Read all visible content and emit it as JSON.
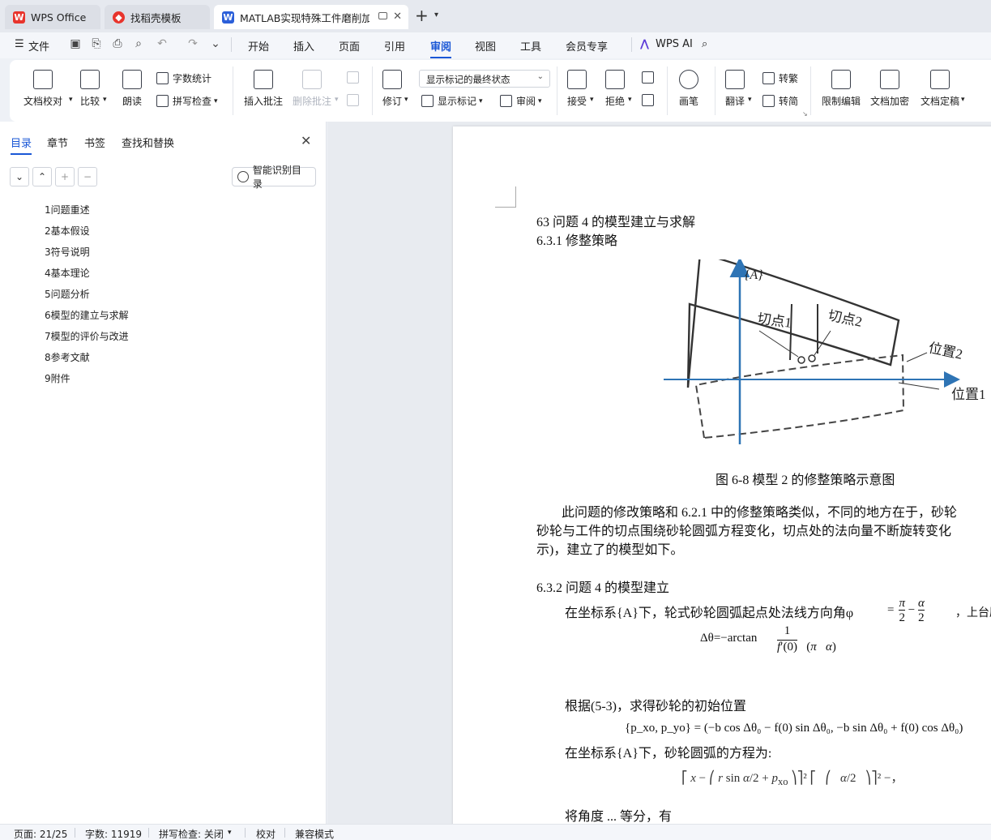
{
  "tabs": [
    {
      "label": "WPS Office",
      "state": "inactive"
    },
    {
      "label": "找稻壳模板",
      "state": "inactive"
    },
    {
      "label": "MATLAB实现特殊工件磨削加工",
      "state": "active"
    }
  ],
  "menu": {
    "file": "文件",
    "items": [
      "开始",
      "插入",
      "页面",
      "引用",
      "审阅",
      "视图",
      "工具",
      "会员专享"
    ],
    "active": "审阅",
    "ai": "WPS AI"
  },
  "ribbon": {
    "proofread": "文档校对",
    "compare": "比较",
    "read_aloud": "朗读",
    "word_count": "字数统计",
    "spell_check": "拼写检查",
    "insert_comment": "插入批注",
    "delete_comment": "删除批注",
    "revise": "修订",
    "markup_state": "显示标记的最终状态",
    "show_markup": "显示标记",
    "review": "审阅",
    "accept": "接受",
    "reject": "拒绝",
    "pen": "画笔",
    "translate": "翻译",
    "to_traditional": "转繁",
    "to_simplified": "转简",
    "restrict_edit": "限制编辑",
    "encrypt": "文档加密",
    "finalize": "文档定稿"
  },
  "nav": {
    "tabs": [
      "目录",
      "章节",
      "书签",
      "查找和替换"
    ],
    "active_tab": "目录",
    "smart_toc": "智能识别目录",
    "toc": [
      "1问题重述",
      "2基本假设",
      "3符号说明",
      "4基本理论",
      "5问题分析",
      "6模型的建立与求解",
      "7模型的评价与改进",
      "8参考文献",
      "9附件"
    ]
  },
  "doc": {
    "heading1": "63 问题 4 的模型建立与求解",
    "heading2": "6.3.1 修整策略",
    "figure": {
      "axis_label": "{A}",
      "point1": "切点1",
      "point2": "切点2",
      "pos2": "位置2",
      "pos1": "位置1"
    },
    "caption": "图 6-8 模型 2 的修整策略示意图",
    "para1_l1": "此问题的修改策略和 6.2.1 中的修整策略类似，不同的地方在于，砂轮",
    "para1_l2": "砂轮与工件的切点围绕砂轮圆弧方程变化，切点处的法向量不断旋转变化",
    "para1_l3": "示)，建立了的模型如下。",
    "heading3": "6.3.2 问题 4 的模型建立",
    "para2": "在坐标系{A}下，轮式砂轮圆弧起点处法线方向角φ",
    "para2_tail": "，上台厕",
    "eq1": "Δθ=−arctan",
    "para3": "根据(5-3)，求得砂轮的初始位置",
    "eq2": "{p_xo, p_yo} = (−b cos Δθ₀ − f(0) sin Δθ₀, −b sin Δθ₀ + f(0) cos Δθ₀)",
    "para4": "在坐标系{A}下，砂轮圆弧的方程为:",
    "para5": "将角度 ... 等分，有"
  },
  "status": {
    "page": "页面: 21/25",
    "words": "字数: 11919",
    "spell": "拼写检查: 关闭",
    "proof": "校对",
    "compat": "兼容模式"
  },
  "colors": {
    "accent": "#1a57d6",
    "axis": "#2e74b5"
  }
}
